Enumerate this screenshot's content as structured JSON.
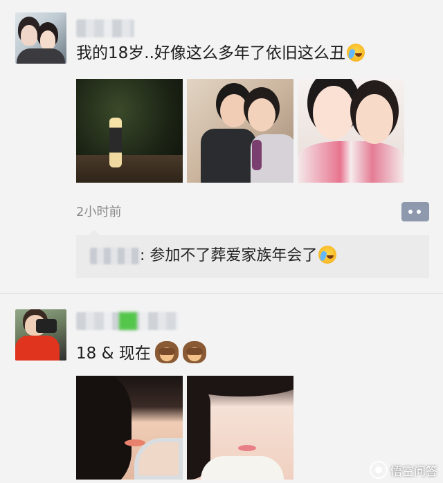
{
  "posts": [
    {
      "text": "我的18岁..好像这么多年了依旧这么丑",
      "emoji": "crying-laughing-emoji",
      "photos": [
        "night-photo",
        "two-friends-photo",
        "pink-outfit-selfie"
      ],
      "time": "2小时前",
      "comment": {
        "text": ": 参加不了葬爱家族年会了",
        "emoji": "crying-laughing-emoji"
      }
    },
    {
      "text": "18 & 现在",
      "emoji": "see-no-evil-monkey-emoji",
      "photos": [
        "face-photo-18",
        "face-photo-now"
      ]
    }
  ],
  "watermark": {
    "text": "悟空问答"
  },
  "colors": {
    "background": "#f3f3f3",
    "comment_box": "#ebebeb",
    "comment_button": "#8e99ae",
    "time_text": "#8a8a8a"
  }
}
